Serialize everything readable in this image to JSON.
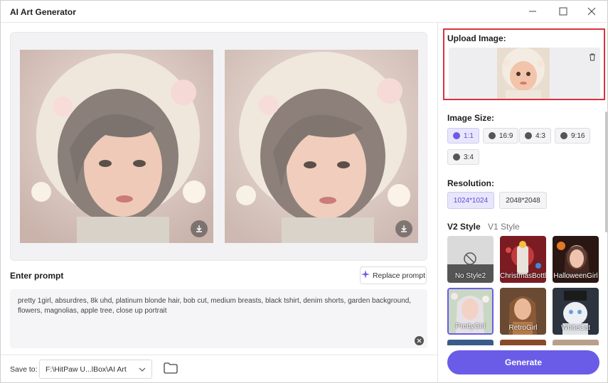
{
  "window": {
    "title": "AI Art Generator",
    "controls": [
      "minimize-icon",
      "maximize-icon",
      "close-icon"
    ]
  },
  "gallery": {
    "images": [
      {
        "name": "generated-image-1",
        "action_icon": "download-icon"
      },
      {
        "name": "generated-image-2",
        "action_icon": "download-icon"
      }
    ]
  },
  "prompt": {
    "label": "Enter prompt",
    "replace_label": "Replace prompt",
    "replace_icon": "sparkle-icon",
    "text": "pretty 1girl, absurdres, 8k uhd, platinum blonde hair, bob cut, medium breasts, black tshirt, denim shorts, garden background, flowers, magnolias, apple tree, close up portrait",
    "clear_icon": "clear-icon"
  },
  "save": {
    "label": "Save to:",
    "path": "F:\\HitPaw U...lBox\\AI Art",
    "folder_icon": "folder-icon"
  },
  "upload": {
    "label": "Upload Image:",
    "delete_icon": "trash-icon"
  },
  "image_size": {
    "label": "Image Size:",
    "options": [
      {
        "label": "1:1",
        "icon": "instagram-icon",
        "selected": true
      },
      {
        "label": "16:9",
        "icon": "facebook-icon",
        "selected": false
      },
      {
        "label": "4:3",
        "icon": "twitter-icon",
        "selected": false
      },
      {
        "label": "9:16",
        "icon": "instagram-icon",
        "selected": false
      },
      {
        "label": "3:4",
        "icon": "twitter-icon",
        "selected": false
      }
    ]
  },
  "resolution": {
    "label": "Resolution:",
    "options": [
      {
        "label": "1024*1024",
        "selected": true
      },
      {
        "label": "2048*2048",
        "selected": false
      }
    ]
  },
  "style": {
    "tabs": [
      {
        "label": "V2 Style",
        "active": true
      },
      {
        "label": "V1 Style",
        "active": false
      }
    ],
    "cards": [
      {
        "label": "No Style2",
        "selected": false
      },
      {
        "label": "ChristmasBottle",
        "selected": false
      },
      {
        "label": "HalloweenGirl",
        "selected": false
      },
      {
        "label": "PrettyGirl",
        "selected": true
      },
      {
        "label": "RetroGirl",
        "selected": false
      },
      {
        "label": "WhiteCat",
        "selected": false
      }
    ]
  },
  "generate": {
    "label": "Generate"
  },
  "colors": {
    "accent": "#6b5ce7",
    "highlight_border": "#d9333f"
  }
}
